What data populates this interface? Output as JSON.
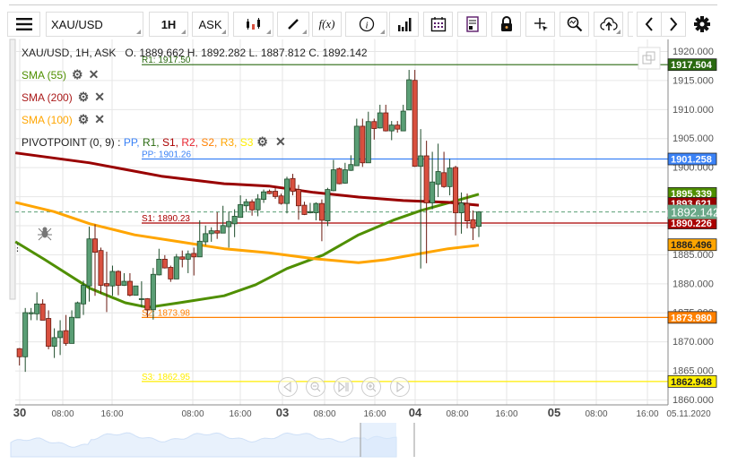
{
  "toolbar": {
    "symbol": "XAU/USD",
    "timeframe": "1H",
    "price_type": "ASK",
    "fx_label": "f(x)"
  },
  "legend": {
    "ohlc": "XAU/USD, 1H, ASK   O. 1889.662 H. 1892.282 L. 1887.812 C. 1892.142",
    "sma55": "SMA (55)",
    "sma200": "SMA (200)",
    "sma100": "SMA (100)",
    "pivot": "PIVOTPOINT (0, 9)",
    "pivot_sep": " : ",
    "pivot_items": [
      "PP,",
      "R1,",
      "S1,",
      "R2,",
      "S2,",
      "R3,",
      "S3"
    ]
  },
  "colors": {
    "up": "#5a9e75",
    "down": "#d9503f",
    "wick_up": "#1e4d2b",
    "wick_down": "#6b1a10",
    "sma55": "#4f8f00",
    "sma200": "#990000",
    "sma100": "#ffa500",
    "pp": "#3b82f6",
    "r1": "#2a6a10",
    "s1": "#aa0000",
    "s2": "#ff8000",
    "s3": "#ffee00",
    "pivot_items": [
      "#3b82f6",
      "#2a6a10",
      "#aa0000",
      "#e8242f",
      "#ff8000",
      "#ffa500",
      "#ffee00"
    ]
  },
  "chart_data": {
    "type": "candlestick",
    "ylim": [
      1858.5,
      1921.5
    ],
    "y_ticks": [
      "1860.000",
      "1865.000",
      "1870.000",
      "1875.000",
      "1880.000",
      "1885.000",
      "1890.000",
      "1895.000",
      "1900.000",
      "1905.000",
      "1910.000",
      "1915.000",
      "1920.000"
    ],
    "y_tick_values": [
      1860,
      1865,
      1870,
      1875,
      1880,
      1885,
      1890,
      1895,
      1900,
      1905,
      1910,
      1915,
      1920
    ],
    "x_labels": [
      "30",
      "08:00",
      "16:00",
      "08:00",
      "16:00",
      "03",
      "08:00",
      "16:00",
      "04",
      "08:00",
      "16:00",
      "05",
      "08:00",
      "16:00",
      "05.11.2020"
    ],
    "x_label_major": [
      true,
      false,
      false,
      false,
      false,
      true,
      false,
      false,
      true,
      false,
      false,
      true,
      false,
      false,
      false
    ],
    "ohlc": [
      [
        1868.6,
        1868.7,
        1865.7,
        1867.2
      ],
      [
        1867.2,
        1875.6,
        1864.6,
        1874.8
      ],
      [
        1874.6,
        1875.6,
        1873.5,
        1874.8
      ],
      [
        1874.6,
        1878.3,
        1873.5,
        1876.3
      ],
      [
        1876.3,
        1877.1,
        1873.5,
        1873.5
      ],
      [
        1873.8,
        1875.2,
        1868.5,
        1869.0
      ],
      [
        1869.0,
        1872.1,
        1867.0,
        1870.5
      ],
      [
        1870.5,
        1873.5,
        1867.5,
        1871.6
      ],
      [
        1871.7,
        1874.4,
        1869.1,
        1869.5
      ],
      [
        1869.5,
        1875.2,
        1869.5,
        1874.0
      ],
      [
        1873.9,
        1876.7,
        1873.9,
        1876.5
      ],
      [
        1876.3,
        1880.3,
        1874.4,
        1879.5
      ],
      [
        1879.4,
        1889.6,
        1876.7,
        1887.5
      ],
      [
        1887.5,
        1890.0,
        1877.7,
        1885.2
      ],
      [
        1885.5,
        1886.0,
        1878.0,
        1879.5
      ],
      [
        1879.8,
        1885.3,
        1874.9,
        1879.4
      ],
      [
        1879.4,
        1882.9,
        1877.7,
        1881.9
      ],
      [
        1881.9,
        1882.1,
        1877.8,
        1879.5
      ],
      [
        1879.5,
        1881.6,
        1879.4,
        1880.2
      ],
      [
        1880.2,
        1881.6,
        1877.6,
        1877.8
      ],
      [
        1877.8,
        1879.4,
        1877.8,
        1879.4
      ],
      [
        1877.1,
        1880.2,
        1875.7,
        1877.2
      ],
      [
        1877.2,
        1877.3,
        1874.0,
        1875.3
      ],
      [
        1875.3,
        1882.5,
        1873.6,
        1881.4
      ],
      [
        1881.3,
        1885.8,
        1881.2,
        1884.0
      ],
      [
        1884.0,
        1884.7,
        1882.4,
        1882.5
      ],
      [
        1882.6,
        1882.9,
        1880.1,
        1880.6
      ],
      [
        1880.6,
        1884.9,
        1880.6,
        1884.4
      ],
      [
        1884.4,
        1885.5,
        1882.6,
        1884.0
      ],
      [
        1884.0,
        1885.5,
        1881.6,
        1884.9
      ],
      [
        1885.0,
        1886.0,
        1881.2,
        1884.4
      ],
      [
        1884.4,
        1890.7,
        1884.4,
        1887.1
      ],
      [
        1887.0,
        1889.8,
        1886.4,
        1888.4
      ],
      [
        1888.4,
        1889.5,
        1887.0,
        1888.9
      ],
      [
        1888.9,
        1892.1,
        1887.5,
        1888.5
      ],
      [
        1888.5,
        1893.2,
        1888.5,
        1889.8
      ],
      [
        1889.6,
        1892.2,
        1886.0,
        1890.5
      ],
      [
        1890.1,
        1892.6,
        1887.8,
        1891.4
      ],
      [
        1891.2,
        1895.0,
        1891.2,
        1893.4
      ],
      [
        1893.2,
        1894.4,
        1892.1,
        1893.9
      ],
      [
        1893.9,
        1894.3,
        1891.5,
        1892.5
      ],
      [
        1892.5,
        1895.2,
        1891.4,
        1894.4
      ],
      [
        1894.3,
        1896.0,
        1893.7,
        1895.6
      ],
      [
        1895.7,
        1896.0,
        1895.2,
        1895.3
      ],
      [
        1895.7,
        1896.3,
        1894.4,
        1894.8
      ],
      [
        1894.9,
        1895.3,
        1893.4,
        1893.6
      ],
      [
        1893.6,
        1898.2,
        1891.9,
        1897.8
      ],
      [
        1897.9,
        1898.7,
        1895.0,
        1895.7
      ],
      [
        1896.0,
        1896.8,
        1890.8,
        1893.2
      ],
      [
        1893.3,
        1893.9,
        1891.6,
        1891.7
      ],
      [
        1892.0,
        1893.7,
        1891.9,
        1892.2
      ],
      [
        1892.0,
        1893.8,
        1890.7,
        1893.6
      ],
      [
        1893.6,
        1894.3,
        1887.1,
        1890.7
      ],
      [
        1890.6,
        1896.3,
        1889.7,
        1896.0
      ],
      [
        1895.8,
        1901.1,
        1895.7,
        1899.4
      ],
      [
        1899.6,
        1899.8,
        1896.9,
        1897.0
      ],
      [
        1897.1,
        1900.6,
        1897.0,
        1899.4
      ],
      [
        1899.3,
        1901.9,
        1899.2,
        1900.3
      ],
      [
        1900.1,
        1908.2,
        1900.1,
        1906.9
      ],
      [
        1906.9,
        1908.2,
        1899.9,
        1900.6
      ],
      [
        1900.6,
        1909.4,
        1900.6,
        1907.7
      ],
      [
        1907.7,
        1908.2,
        1904.6,
        1906.5
      ],
      [
        1906.6,
        1910.6,
        1906.5,
        1909.2
      ],
      [
        1909.2,
        1910.6,
        1906.0,
        1906.1
      ],
      [
        1906.1,
        1907.8,
        1904.5,
        1907.1
      ],
      [
        1907.1,
        1907.8,
        1905.8,
        1906.4
      ],
      [
        1906.1,
        1910.6,
        1906.1,
        1909.5
      ],
      [
        1909.7,
        1916.6,
        1909.7,
        1914.9
      ],
      [
        1914.8,
        1916.6,
        1899.9,
        1900.0
      ],
      [
        1900.0,
        1906.4,
        1882.4,
        1901.8
      ],
      [
        1901.8,
        1904.4,
        1883.3,
        1893.7
      ],
      [
        1893.7,
        1902.5,
        1892.6,
        1897.3
      ],
      [
        1896.9,
        1903.9,
        1894.7,
        1899.1
      ],
      [
        1898.9,
        1902.5,
        1896.3,
        1896.5
      ],
      [
        1896.5,
        1901.3,
        1895.0,
        1899.7
      ],
      [
        1899.8,
        1900.1,
        1888.1,
        1892.0
      ],
      [
        1892.0,
        1895.5,
        1888.4,
        1893.7
      ],
      [
        1893.6,
        1895.3,
        1889.3,
        1890.6
      ],
      [
        1890.8,
        1892.4,
        1887.3,
        1889.4
      ],
      [
        1889.662,
        1892.282,
        1887.812,
        1892.142
      ]
    ],
    "sma": [
      {
        "name": "SMA (55)",
        "color_key": "sma55",
        "points": [
          [
            -0.7,
            1887.0
          ],
          [
            4.4,
            1883.9
          ],
          [
            12.1,
            1879.0
          ],
          [
            18.2,
            1876.5
          ],
          [
            22.1,
            1875.7
          ],
          [
            27.5,
            1876.5
          ],
          [
            35.2,
            1877.7
          ],
          [
            40.6,
            1879.6
          ],
          [
            46.0,
            1882.4
          ],
          [
            52.2,
            1884.7
          ],
          [
            58.3,
            1888.2
          ],
          [
            64.5,
            1890.8
          ],
          [
            69.1,
            1892.4
          ],
          [
            74.5,
            1893.9
          ],
          [
            79,
            1895.2
          ]
        ]
      },
      {
        "name": "SMA (200)",
        "color_key": "sma200",
        "points": [
          [
            -0.7,
            1902.3
          ],
          [
            12.1,
            1900.6
          ],
          [
            24.4,
            1898.3
          ],
          [
            35.2,
            1897.0
          ],
          [
            42.9,
            1896.6
          ],
          [
            50.6,
            1895.5
          ],
          [
            58.3,
            1894.7
          ],
          [
            66.0,
            1894.1
          ],
          [
            73.7,
            1893.8
          ],
          [
            79,
            1893.3
          ]
        ]
      },
      {
        "name": "SMA (100)",
        "color_key": "sma100",
        "points": [
          [
            -0.7,
            1893.8
          ],
          [
            5.9,
            1892.2
          ],
          [
            12.1,
            1890.1
          ],
          [
            19.8,
            1888.2
          ],
          [
            27.5,
            1887.0
          ],
          [
            35.2,
            1885.8
          ],
          [
            42.9,
            1885.1
          ],
          [
            50.6,
            1884.1
          ],
          [
            58.3,
            1883.4
          ],
          [
            62.9,
            1883.9
          ],
          [
            69.1,
            1885.0
          ],
          [
            73.7,
            1885.8
          ],
          [
            79,
            1886.4
          ]
        ]
      }
    ],
    "pivots": [
      {
        "label": "R1: 1917.50",
        "value": 1917.504,
        "tag": "1917.504",
        "color_key": "r1",
        "text_color": "#fff"
      },
      {
        "label": "PP: 1901.26",
        "value": 1901.258,
        "tag": "1901.258",
        "color_key": "pp",
        "text_color": "#fff"
      },
      {
        "label": "S1: 1890.23",
        "value": 1890.226,
        "tag": "1890.226",
        "color_key": "s1",
        "text_color": "#fff"
      },
      {
        "label": "S2: 1873.98",
        "value": 1873.98,
        "tag": "1873.980",
        "color_key": "s2",
        "text_color": "#fff"
      },
      {
        "label": "S3: 1862.95",
        "value": 1862.948,
        "tag": "1862.948",
        "color_key": "s3",
        "text_color": "#222"
      }
    ],
    "sma_tags": [
      {
        "tag": "1895.339",
        "value": 1895.339,
        "color": "#4f8f00",
        "text_color": "#fff"
      },
      {
        "tag": "1893.621",
        "value": 1893.621,
        "color": "#990000",
        "text_color": "#fff"
      },
      {
        "tag": "1886.496",
        "value": 1886.496,
        "color": "#ffa500",
        "text_color": "#222"
      }
    ],
    "last_price": {
      "tag": "1892.142",
      "value": 1892.142,
      "color": "#6aa888"
    }
  }
}
